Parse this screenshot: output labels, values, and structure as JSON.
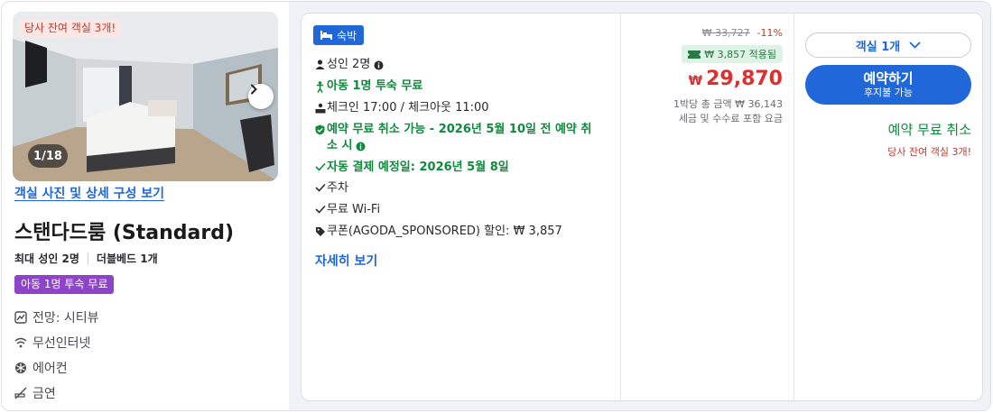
{
  "room": {
    "scarcity_badge": "당사 잔여 객실 3개!",
    "photo_counter": "1/18",
    "photo_link": "객실 사진 및 상세 구성 보기",
    "title": "스탠다드룸 (Standard)",
    "max_occupancy": "최대 성인 2명",
    "bed": "더블베드 1개",
    "kids_badge": "아동 1명 투숙 무료",
    "features": [
      {
        "icon": "view-icon",
        "label": "전망: 시티뷰"
      },
      {
        "icon": "wifi-icon",
        "label": "무선인터넷"
      },
      {
        "icon": "snowflake-icon",
        "label": "에어컨"
      },
      {
        "icon": "no-smoking-icon",
        "label": "금연"
      }
    ]
  },
  "offer": {
    "stay_badge": "숙박",
    "benefits": {
      "adults": "성인 2명",
      "kids_free": "아동 1명 투숙 무료",
      "checkin": "체크인 17:00 / 체크아웃 11:00",
      "free_cancel_line1": "예약 무료 취소 가능 - 2026년 5월 10일 전 예약 취",
      "free_cancel_line2": "소 시",
      "auto_payment": "자동 결제 예정일: 2026년 5월 8일",
      "parking": "주차",
      "wifi": "무료 Wi-Fi",
      "coupon": "쿠폰(AGODA_SPONSORED) 할인: ₩ 3,857"
    },
    "more_link": "자세히 보기"
  },
  "pricing": {
    "original_price": "₩ 33,727",
    "discount": "-11%",
    "coupon_applied": "₩ 3,857 적용됨",
    "currency": "₩",
    "price": "29,870",
    "per_night": "1박당 총 금액 ₩ 36,143",
    "tax_note": "세금 및 수수료 포함 요금"
  },
  "action": {
    "room_select": "객실 1개",
    "book_main": "예약하기",
    "book_sub": "후지불 가능",
    "free_cancel": "예약 무료 취소",
    "rooms_left": "당사 잔여 객실 3개!"
  },
  "colors": {
    "brand_blue": "#2067da",
    "green": "#0f8a3c",
    "price_red": "#e12d2d",
    "purple_badge": "#8e44c8"
  }
}
